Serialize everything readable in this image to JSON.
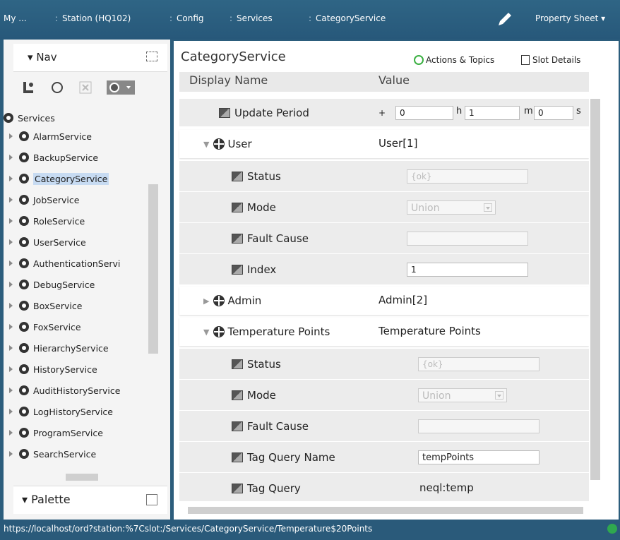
{
  "topbar": {
    "items": [
      "My ...",
      "Station (HQ102)",
      "Config",
      "Services",
      "CategoryService"
    ],
    "view": "Property Sheet"
  },
  "nav": {
    "title": "Nav",
    "root": "Services",
    "items": [
      "AlarmService",
      "BackupService",
      "CategoryService",
      "JobService",
      "RoleService",
      "UserService",
      "AuthenticationServi",
      "DebugService",
      "BoxService",
      "FoxService",
      "HierarchyService",
      "HistoryService",
      "AuditHistoryService",
      "LogHistoryService",
      "ProgramService",
      "SearchService"
    ],
    "selected": "CategoryService",
    "palette": "Palette"
  },
  "sheet": {
    "title": "CategoryService",
    "actions": "Actions & Topics",
    "slots": "Slot Details",
    "col_name": "Display Name",
    "col_value": "Value",
    "update_period": {
      "label": "Update Period",
      "h": "0",
      "m": "1",
      "s": "0"
    },
    "user": {
      "label": "User",
      "value": "User[1]",
      "status_label": "Status",
      "status": "{ok}",
      "mode_label": "Mode",
      "mode": "Union",
      "fault_label": "Fault Cause",
      "fault": "",
      "index_label": "Index",
      "index": "1"
    },
    "admin": {
      "label": "Admin",
      "value": "Admin[2]"
    },
    "temp": {
      "label": "Temperature Points",
      "value": "Temperature Points",
      "status_label": "Status",
      "status": "{ok}",
      "mode_label": "Mode",
      "mode": "Union",
      "fault_label": "Fault Cause",
      "fault": "",
      "tagname_label": "Tag Query Name",
      "tagname": "tempPoints",
      "tagquery_label": "Tag Query",
      "tagquery": "neql:temp"
    }
  },
  "status": {
    "url": "https://localhost/ord?station:%7Cslot:/Services/CategoryService/Temperature$20Points"
  }
}
